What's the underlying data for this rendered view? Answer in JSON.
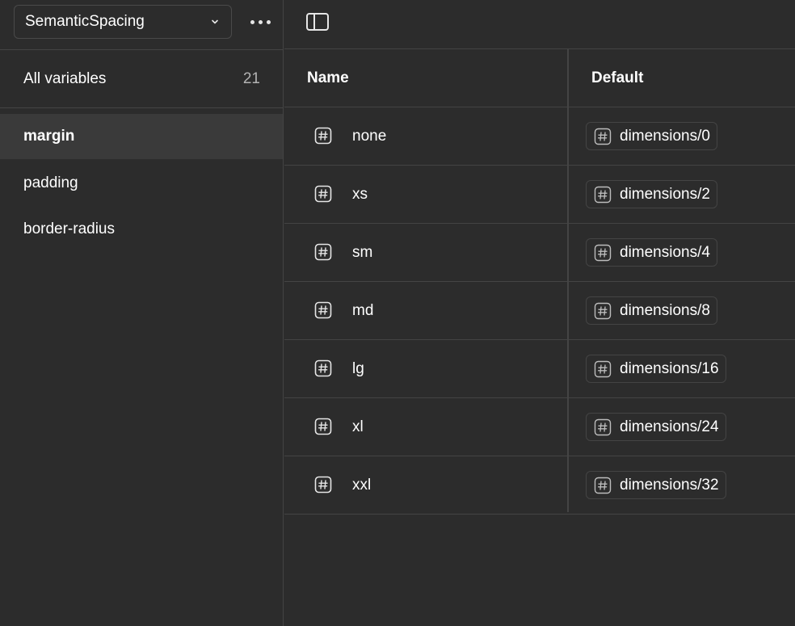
{
  "sidebar": {
    "collection": {
      "selected": "SemanticSpacing"
    },
    "all_variables": {
      "label": "All variables",
      "count": "21"
    },
    "groups": [
      {
        "label": "margin",
        "selected": true
      },
      {
        "label": "padding",
        "selected": false
      },
      {
        "label": "border-radius",
        "selected": false
      }
    ]
  },
  "table": {
    "columns": {
      "name": "Name",
      "default": "Default"
    },
    "rows": [
      {
        "name": "none",
        "value": "dimensions/0"
      },
      {
        "name": "xs",
        "value": "dimensions/2"
      },
      {
        "name": "sm",
        "value": "dimensions/4"
      },
      {
        "name": "md",
        "value": "dimensions/8"
      },
      {
        "name": "lg",
        "value": "dimensions/16"
      },
      {
        "name": "xl",
        "value": "dimensions/24"
      },
      {
        "name": "xxl",
        "value": "dimensions/32"
      }
    ]
  },
  "icons": {
    "collection_dropdown": "chevron-down-icon",
    "more": "more-icon",
    "panel_toggle": "sidebar-panel-icon",
    "number_variable": "number-variable-icon",
    "alias": "number-alias-icon"
  },
  "colors": {
    "background": "#2c2c2c",
    "selected_row": "#3a3a3a",
    "divider": "#444444",
    "text": "#ffffff",
    "muted_text": "#b3b3b3"
  }
}
